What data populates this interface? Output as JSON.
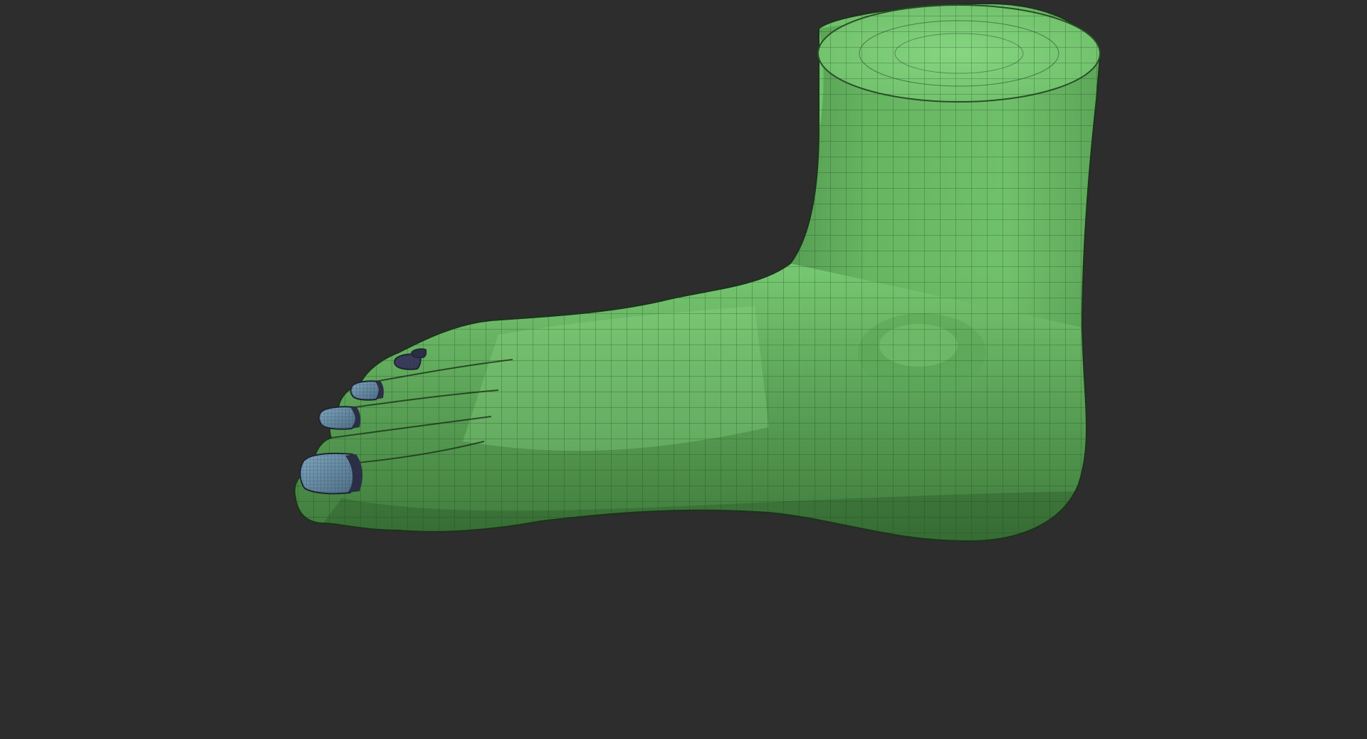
{
  "viewport": {
    "background_color": "#2d2d2d"
  },
  "model": {
    "subject": "foot",
    "display_mode": "polyframe",
    "skin_color": "#74c46f",
    "skin_shadow_color": "#4f9a4c",
    "skin_highlight_color": "#8fd98a",
    "wire_color": "#1d3d1c",
    "nail_color": "#6c8fa6",
    "nail_dark_color": "#2b2f45",
    "nail_count": 5
  }
}
